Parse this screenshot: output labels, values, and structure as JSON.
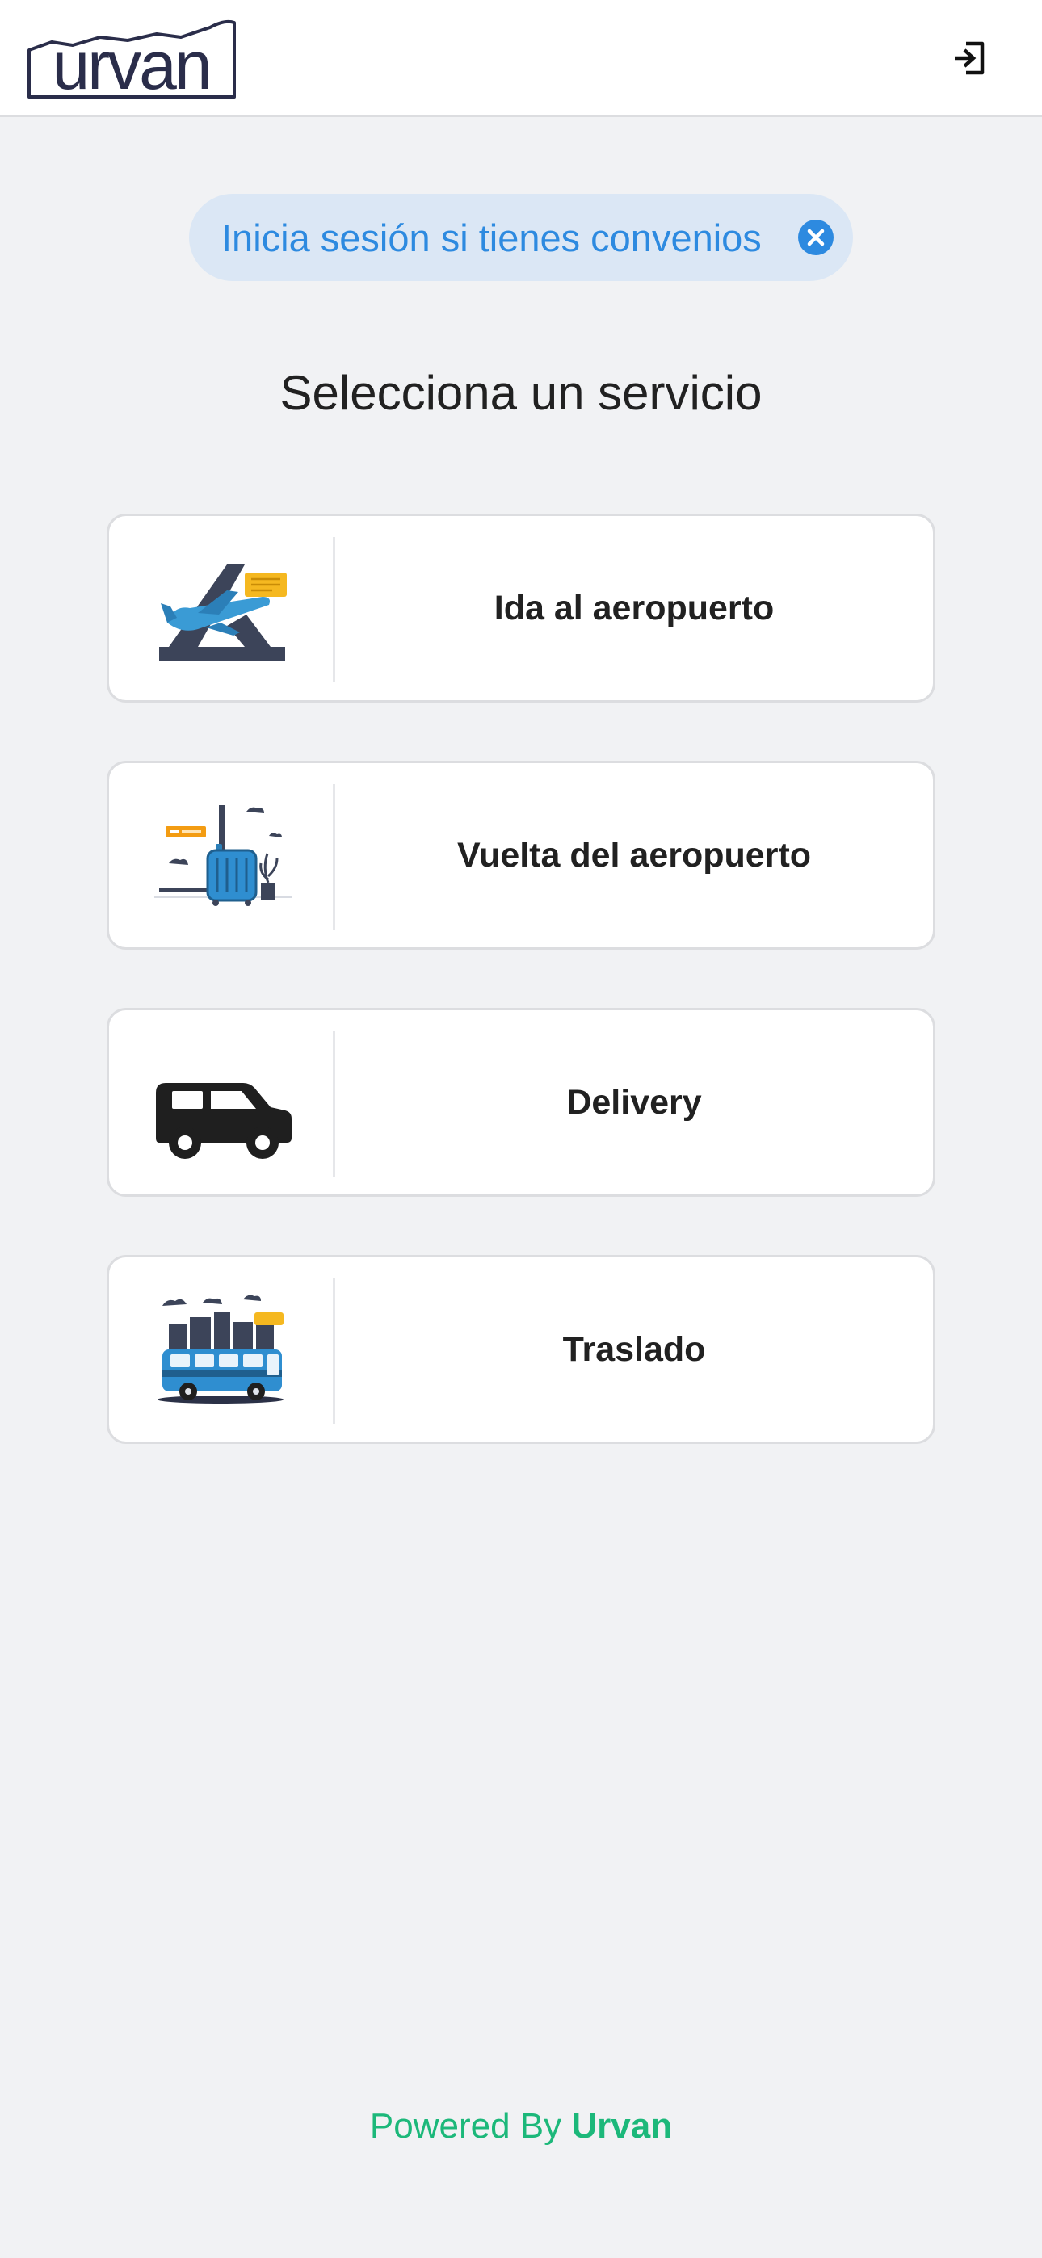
{
  "header": {
    "logo_text": "urvan",
    "login_icon": "login-icon"
  },
  "banner": {
    "text": "Inicia sesión si tienes convenios",
    "close_icon": "close-circle-icon",
    "color": "#2d8ae0"
  },
  "page_title": "Selecciona un servicio",
  "services": [
    {
      "label": "Ida al aeropuerto",
      "icon": "airplane-departure-icon"
    },
    {
      "label": "Vuelta del aeropuerto",
      "icon": "luggage-arrival-icon"
    },
    {
      "label": "Delivery",
      "icon": "van-icon"
    },
    {
      "label": "Traslado",
      "icon": "bus-transfer-icon"
    }
  ],
  "footer": {
    "prefix": "Powered By",
    "brand": "Urvan",
    "color": "#1cb87a"
  }
}
